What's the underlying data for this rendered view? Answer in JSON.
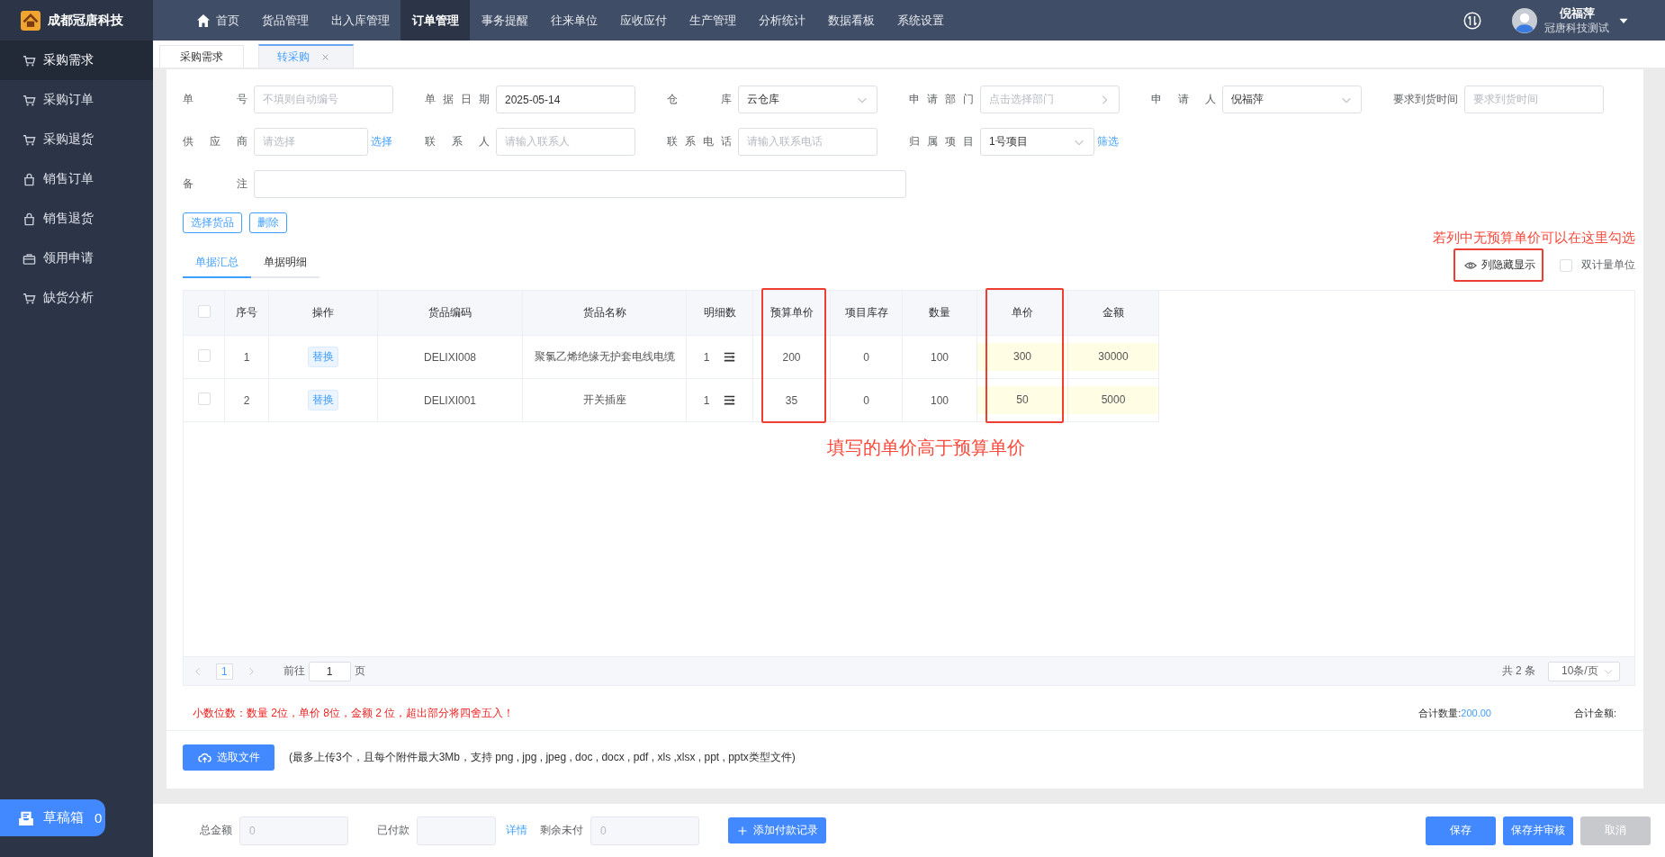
{
  "brand": {
    "name": "成都冠唐科技"
  },
  "top_nav": [
    {
      "label": "首页",
      "kind": "home",
      "selected": false
    },
    {
      "label": "货品管理",
      "kind": "link",
      "selected": false
    },
    {
      "label": "出入库管理",
      "kind": "link",
      "selected": false
    },
    {
      "label": "订单管理",
      "kind": "link",
      "selected": true
    },
    {
      "label": "事务提醒",
      "kind": "link",
      "selected": false
    },
    {
      "label": "往来单位",
      "kind": "link",
      "selected": false
    },
    {
      "label": "应收应付",
      "kind": "link",
      "selected": false
    },
    {
      "label": "生产管理",
      "kind": "link",
      "selected": false
    },
    {
      "label": "分析统计",
      "kind": "link",
      "selected": false
    },
    {
      "label": "数据看板",
      "kind": "link",
      "selected": false
    },
    {
      "label": "系统设置",
      "kind": "link",
      "selected": false
    }
  ],
  "user": {
    "name": "倪福萍",
    "company": "冠唐科技测试"
  },
  "sidebar": {
    "items": [
      {
        "label": "采购需求",
        "kind": "cart",
        "selected": true
      },
      {
        "label": "采购订单",
        "kind": "cart",
        "selected": false
      },
      {
        "label": "采购退货",
        "kind": "cart",
        "selected": false
      },
      {
        "label": "销售订单",
        "kind": "bag",
        "selected": false
      },
      {
        "label": "销售退货",
        "kind": "bag",
        "selected": false
      },
      {
        "label": "领用申请",
        "kind": "case",
        "selected": false
      },
      {
        "label": "缺货分析",
        "kind": "cart",
        "selected": false
      }
    ],
    "draft_box": {
      "label": "草稿箱",
      "count": "0"
    }
  },
  "page_tabs": [
    {
      "label": "采购需求",
      "selected": false,
      "closable": false
    },
    {
      "label": "转采购",
      "selected": true,
      "closable": true
    }
  ],
  "form": {
    "rows": [
      [
        {
          "label": "单号",
          "kind": "text",
          "placeholder": "不填则自动编号"
        },
        {
          "label": "单据日期",
          "kind": "text",
          "value": "2025-05-14"
        },
        {
          "label": "仓库",
          "kind": "select",
          "value": "云仓库"
        },
        {
          "label": "申请部门",
          "kind": "picker",
          "placeholder": "点击选择部门"
        },
        {
          "label": "申请人",
          "kind": "select",
          "value": "倪福萍"
        },
        {
          "label": "要求到货时间",
          "kind": "text",
          "placeholder": "要求到货时间"
        }
      ],
      [
        {
          "label": "供应商",
          "kind": "short",
          "placeholder": "请选择",
          "link": "选择"
        },
        {
          "label": "联系人",
          "kind": "text",
          "placeholder": "请输入联系人"
        },
        {
          "label": "联系电话",
          "kind": "text",
          "placeholder": "请输入联系电话"
        },
        {
          "label": "归属项目",
          "kind": "shortselect",
          "value": "1号项目",
          "link": "筛选"
        }
      ],
      [
        {
          "label": "备注",
          "kind": "wide"
        }
      ]
    ]
  },
  "actions": [
    "选择货品",
    "删除"
  ],
  "hint": "若列中无预算单价可以在这里勾选",
  "detail_tabs": [
    {
      "label": "单据汇总",
      "selected": true
    },
    {
      "label": "单据明细",
      "selected": false
    }
  ],
  "column_toggle": {
    "label": "列隐藏显示",
    "highlighted": true
  },
  "dual_unit": {
    "label": "双计量单位",
    "checked": false
  },
  "table": {
    "all_checked": false,
    "columns": [
      {
        "label": "序号",
        "kind": "text",
        "highlighted": false
      },
      {
        "label": "操作",
        "kind": "action",
        "highlighted": false
      },
      {
        "label": "货品编码",
        "kind": "text",
        "highlighted": false
      },
      {
        "label": "货品名称",
        "kind": "text",
        "highlighted": false
      },
      {
        "label": "明细数",
        "kind": "detail",
        "highlighted": false
      },
      {
        "label": "预算单价",
        "kind": "text",
        "highlighted": true
      },
      {
        "label": "项目库存",
        "kind": "text",
        "highlighted": false
      },
      {
        "label": "数量",
        "kind": "text",
        "highlighted": false
      },
      {
        "label": "单价",
        "kind": "input",
        "highlighted": true
      },
      {
        "label": "金额",
        "kind": "input",
        "highlighted": false
      }
    ],
    "rows": [
      {
        "checked": false,
        "cells": [
          "1",
          "替换",
          "DELIXI008",
          "聚氯乙烯绝缘无护套电线电缆",
          "1",
          "200",
          "0",
          "100",
          "300",
          "30000"
        ]
      },
      {
        "checked": false,
        "cells": [
          "2",
          "替换",
          "DELIXI001",
          "开关插座",
          "1",
          "35",
          "0",
          "100",
          "50",
          "5000"
        ]
      }
    ]
  },
  "annotation": "填写的单价高于预算单价",
  "pagination": {
    "current": "1",
    "goto_label": "前往",
    "goto_value": "1",
    "page_suffix": "页",
    "total": "共 2 条",
    "page_size": "10条/页"
  },
  "summary": {
    "note": "小数位数：数量 2位，单价 8位，金额 2 位，超出部分将四舍五入！",
    "qty_label": "合计数量:",
    "qty": "200.00",
    "amount_label": "合计金额:"
  },
  "upload": {
    "button": "选取文件",
    "hint": "(最多上传3个，且每个附件最大3Mb，支持 png , jpg , jpeg , doc , docx , pdf , xls ,xlsx , ppt , pptx类型文件)"
  },
  "footer": {
    "fields": [
      {
        "label": "总金额",
        "placeholder": "0"
      },
      {
        "label": "已付款",
        "link": "详情"
      },
      {
        "label": "剩余未付",
        "placeholder": "0"
      }
    ],
    "add_payment": "添加付款记录",
    "buttons": [
      {
        "label": "保存",
        "disabled": false
      },
      {
        "label": "保存并审核",
        "disabled": false
      },
      {
        "label": "取消",
        "disabled": true
      }
    ]
  }
}
